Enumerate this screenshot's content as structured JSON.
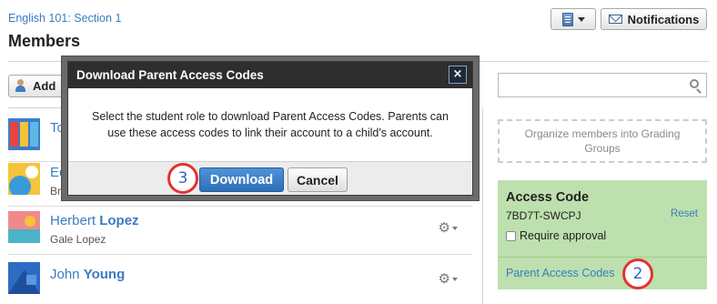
{
  "header": {
    "course_link": "English 101: Section 1",
    "page_title": "Members",
    "notifications_label": "Notifications"
  },
  "toolbar": {
    "add_label": "Add"
  },
  "members": [
    {
      "name_first": "To",
      "name_last": "",
      "parent": ""
    },
    {
      "name_first": "Ec",
      "name_last": "",
      "parent": "Br"
    },
    {
      "name_first": "Herbert",
      "name_last": "Lopez",
      "parent": "Gale Lopez"
    },
    {
      "name_first": "John",
      "name_last": "Young",
      "parent": ""
    }
  ],
  "sidebar": {
    "grading_groups": "Organize members into Grading Groups",
    "access_code_title": "Access Code",
    "access_code_value": "7BD7T-SWCPJ",
    "reset_label": "Reset",
    "require_approval_label": "Require approval",
    "parent_codes_link": "Parent Access Codes"
  },
  "modal": {
    "title": "Download Parent Access Codes",
    "close_glyph": "×",
    "body": "Select the student role to download Parent Access Codes. Parents can use these access codes to link their account to a child's account.",
    "download_label": "Download",
    "cancel_label": "Cancel"
  },
  "step_markers": {
    "download_step": "3",
    "parent_codes_step": "2"
  },
  "icons": {
    "view_toggle": "notebook-icon",
    "notifications": "envelope-icon",
    "add": "add-user-icon",
    "search": "search-icon",
    "row_menu": "gear-icon"
  },
  "colors": {
    "link": "#3a7cc0",
    "access_card": "#bde0ae",
    "primary_button": "#2f6fb5",
    "step_marker_ring": "#e3322f",
    "modal_header": "#2e2e2e"
  }
}
